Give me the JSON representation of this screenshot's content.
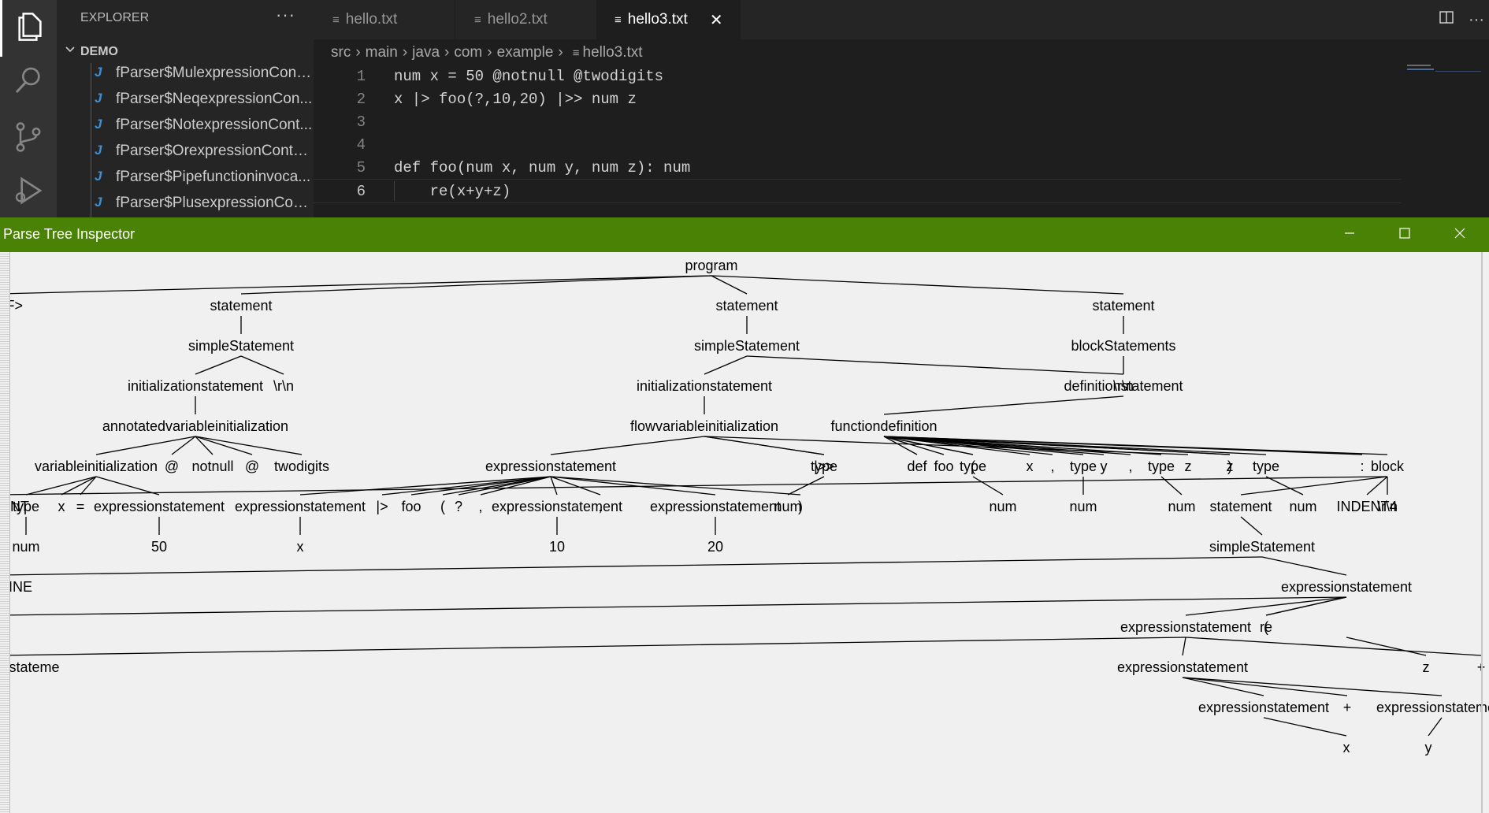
{
  "editor": {
    "sidebar": {
      "title": "EXPLORER",
      "more": "···",
      "folder": "DEMO",
      "file_icon": "J",
      "files": [
        "fParser$MulexpressionCont...",
        "fParser$NeqexpressionCon...",
        "fParser$NotexpressionCont...",
        "fParser$OrexpressionConte...",
        "fParser$Pipefunctioninvoca...",
        "fParser$PlusexpressionCon..."
      ]
    },
    "tabs": [
      {
        "label": "hello.txt",
        "active": false
      },
      {
        "label": "hello2.txt",
        "active": false
      },
      {
        "label": "hello3.txt",
        "active": true
      }
    ],
    "tab_close": "✕",
    "breadcrumbs": [
      "src",
      "main",
      "java",
      "com",
      "example",
      "hello3.txt"
    ],
    "code_lines": [
      {
        "no": "1",
        "text": "num x = 50 @notnull @twodigits"
      },
      {
        "no": "2",
        "text": "x |> foo(?,10,20) |>> num z"
      },
      {
        "no": "3",
        "text": ""
      },
      {
        "no": "4",
        "text": ""
      },
      {
        "no": "5",
        "text": "def foo(num x, num y, num z): num"
      },
      {
        "no": "6",
        "text": "    re(x+y+z)"
      }
    ],
    "current_line": 6,
    "icons": [
      "files-icon",
      "search-icon",
      "source-control-icon",
      "run-debug-icon",
      "split-editor-icon"
    ]
  },
  "inspector": {
    "title": "Parse Tree Inspector",
    "accent": "#498205",
    "buttons": {
      "minimize": "—",
      "maximize": "☐",
      "close": "✕"
    },
    "tree": {
      "label": "program",
      "children": [
        {
          "label": "statement",
          "children": [
            {
              "label": "simpleStatement",
              "children": [
                {
                  "label": "initializationstatement",
                  "children": [
                    {
                      "label": "annotatedvariableinitialization",
                      "children": [
                        {
                          "label": "variableinitialization",
                          "children": [
                            {
                              "label": "type",
                              "children": [
                                {
                                  "label": "num"
                                }
                              ]
                            },
                            {
                              "label": "x"
                            },
                            {
                              "label": "="
                            },
                            {
                              "label": "expressionstatement",
                              "children": [
                                {
                                  "label": "50"
                                }
                              ]
                            }
                          ]
                        },
                        {
                          "label": "@"
                        },
                        {
                          "label": "notnull"
                        },
                        {
                          "label": "@"
                        },
                        {
                          "label": "twodigits"
                        }
                      ]
                    }
                  ]
                },
                {
                  "label": "\\r\\n"
                }
              ]
            }
          ]
        },
        {
          "label": "statement",
          "children": [
            {
              "label": "simpleStatement",
              "children": [
                {
                  "label": "initializationstatement",
                  "children": [
                    {
                      "label": "flowvariableinitialization",
                      "children": [
                        {
                          "label": "expressionstatement",
                          "children": [
                            {
                              "label": "expressionstatement",
                              "children": [
                                {
                                  "label": "x"
                                }
                              ]
                            },
                            {
                              "label": "|>"
                            },
                            {
                              "label": "foo"
                            },
                            {
                              "label": "("
                            },
                            {
                              "label": "?"
                            },
                            {
                              "label": ","
                            },
                            {
                              "label": "expressionstatement",
                              "children": [
                                {
                                  "label": "10"
                                }
                              ]
                            },
                            {
                              "label": ","
                            },
                            {
                              "label": "expressionstatement",
                              "children": [
                                {
                                  "label": "20"
                                }
                              ]
                            },
                            {
                              "label": ")"
                            }
                          ]
                        },
                        {
                          "label": "|>>"
                        },
                        {
                          "label": "type",
                          "children": [
                            {
                              "label": "num"
                            }
                          ]
                        },
                        {
                          "label": "z"
                        }
                      ]
                    }
                  ]
                },
                {
                  "label": "\\r\\n"
                }
              ]
            }
          ]
        },
        {
          "label": "statement",
          "children": [
            {
              "label": "blockStatements",
              "children": [
                {
                  "label": "definitionstatement",
                  "children": [
                    {
                      "label": "functiondefinition",
                      "children": [
                        {
                          "label": "def"
                        },
                        {
                          "label": "foo"
                        },
                        {
                          "label": "("
                        },
                        {
                          "label": "type",
                          "children": [
                            {
                              "label": "num"
                            }
                          ]
                        },
                        {
                          "label": "x"
                        },
                        {
                          "label": ","
                        },
                        {
                          "label": "type",
                          "children": [
                            {
                              "label": "num"
                            }
                          ]
                        },
                        {
                          "label": "y"
                        },
                        {
                          "label": ","
                        },
                        {
                          "label": "type",
                          "children": [
                            {
                              "label": "num"
                            }
                          ]
                        },
                        {
                          "label": "z"
                        },
                        {
                          "label": ")"
                        },
                        {
                          "label": ":"
                        },
                        {
                          "label": "type",
                          "children": [
                            {
                              "label": "num"
                            }
                          ]
                        },
                        {
                          "label": "block",
                          "children": [
                            {
                              "label": "\\r\\n"
                            },
                            {
                              "label": "INDENT4"
                            },
                            {
                              "label": "statement",
                              "children": [
                                {
                                  "label": "simpleStatement",
                                  "children": [
                                    {
                                      "label": "expressionstatement",
                                      "children": [
                                        {
                                          "label": "re"
                                        },
                                        {
                                          "label": "("
                                        },
                                        {
                                          "label": "expressionstatement",
                                          "children": [
                                            {
                                              "label": "expressionstatement",
                                              "children": [
                                                {
                                                  "label": "expressionstatement",
                                                  "children": [
                                                    {
                                                      "label": "x"
                                                    }
                                                  ]
                                                },
                                                {
                                                  "label": "+"
                                                },
                                                {
                                                  "label": "expressionstatement",
                                                  "children": [
                                                    {
                                                      "label": "y"
                                                    }
                                                  ]
                                                }
                                              ]
                                            },
                                            {
                                              "label": "+"
                                            },
                                            {
                                              "label": "expressionstateme"
                                            }
                                          ]
                                        },
                                        {
                                          "label": ")"
                                        }
                                      ]
                                    },
                                    {
                                      "label": "NEWLINE"
                                    }
                                  ]
                                }
                              ]
                            },
                            {
                              "label": "DEDENT"
                            }
                          ]
                        }
                      ]
                    }
                  ]
                }
              ]
            }
          ]
        },
        {
          "label": "<EOF>"
        }
      ]
    },
    "extra_nodes": [
      {
        "label": "z",
        "parent": "expressionstatement + expressionstatement z"
      }
    ]
  }
}
